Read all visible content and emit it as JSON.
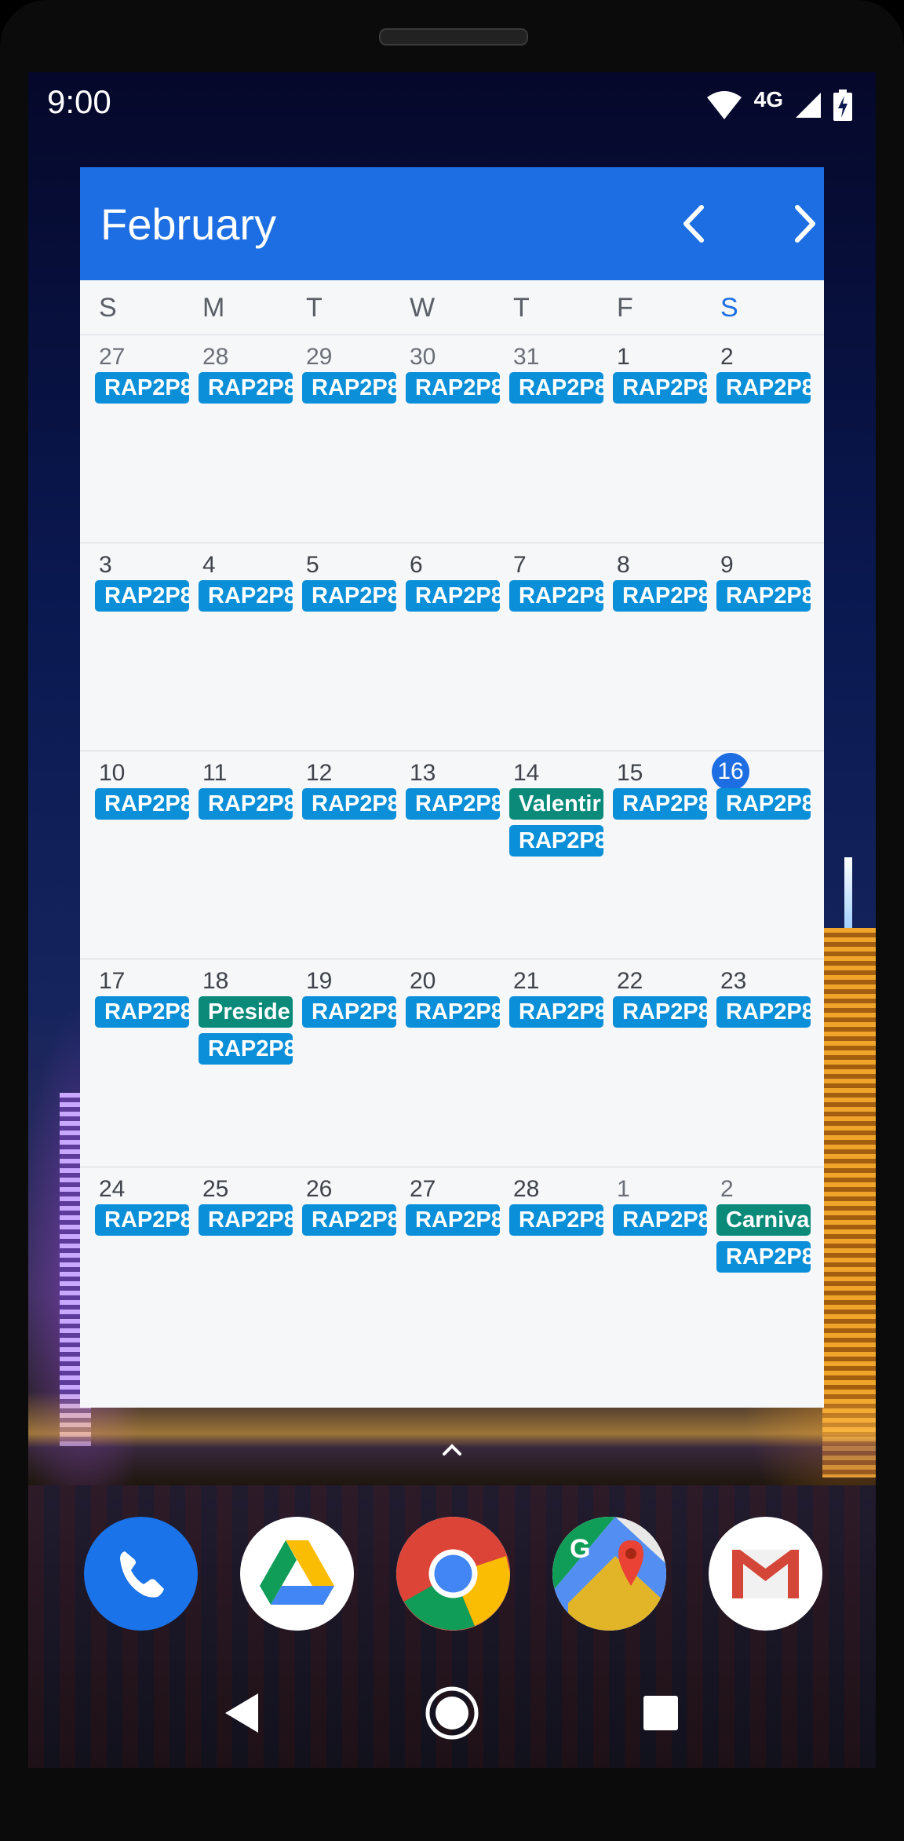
{
  "status_bar": {
    "time": "9:00",
    "network": "4G",
    "icons": [
      "wifi-icon",
      "cell-signal-icon",
      "battery-charging-icon"
    ]
  },
  "widget": {
    "month": "February",
    "prev_icon": "chevron-left-icon",
    "next_icon": "chevron-right-icon",
    "weekdays": [
      "S",
      "M",
      "T",
      "W",
      "T",
      "F",
      "S"
    ],
    "weeks": [
      {
        "days": [
          {
            "n": "27",
            "events": [
              "RAP2P8"
            ]
          },
          {
            "n": "28",
            "events": [
              "RAP2P8"
            ]
          },
          {
            "n": "29",
            "events": [
              "RAP2P8"
            ]
          },
          {
            "n": "30",
            "events": [
              "RAP2P8"
            ]
          },
          {
            "n": "31",
            "events": [
              "RAP2P8"
            ]
          },
          {
            "n": "1",
            "events": [
              "RAP2P8"
            ]
          },
          {
            "n": "2",
            "events": [
              "RAP2P8"
            ]
          }
        ]
      },
      {
        "days": [
          {
            "n": "3",
            "events": [
              "RAP2P8"
            ]
          },
          {
            "n": "4",
            "events": [
              "RAP2P8"
            ]
          },
          {
            "n": "5",
            "events": [
              "RAP2P8"
            ]
          },
          {
            "n": "6",
            "events": [
              "RAP2P8"
            ]
          },
          {
            "n": "7",
            "events": [
              "RAP2P8"
            ]
          },
          {
            "n": "8",
            "events": [
              "RAP2P8"
            ]
          },
          {
            "n": "9",
            "events": [
              "RAP2P8"
            ]
          }
        ]
      },
      {
        "days": [
          {
            "n": "10",
            "events": [
              "RAP2P8"
            ]
          },
          {
            "n": "11",
            "events": [
              "RAP2P8"
            ]
          },
          {
            "n": "12",
            "events": [
              "RAP2P8"
            ]
          },
          {
            "n": "13",
            "events": [
              "RAP2P8"
            ]
          },
          {
            "n": "14",
            "events": [
              "Valentir",
              "RAP2P8"
            ]
          },
          {
            "n": "15",
            "events": [
              "RAP2P8"
            ]
          },
          {
            "n": "16",
            "today": true,
            "events": [
              "RAP2P8"
            ]
          }
        ]
      },
      {
        "days": [
          {
            "n": "17",
            "events": [
              "RAP2P8"
            ]
          },
          {
            "n": "18",
            "events": [
              "Preside",
              "RAP2P8"
            ]
          },
          {
            "n": "19",
            "events": [
              "RAP2P8"
            ]
          },
          {
            "n": "20",
            "events": [
              "RAP2P8"
            ]
          },
          {
            "n": "21",
            "events": [
              "RAP2P8"
            ]
          },
          {
            "n": "22",
            "events": [
              "RAP2P8"
            ]
          },
          {
            "n": "23",
            "events": [
              "RAP2P8"
            ]
          }
        ]
      },
      {
        "days": [
          {
            "n": "24",
            "events": [
              "RAP2P8"
            ]
          },
          {
            "n": "25",
            "events": [
              "RAP2P8"
            ]
          },
          {
            "n": "26",
            "events": [
              "RAP2P8"
            ]
          },
          {
            "n": "27",
            "events": [
              "RAP2P8"
            ]
          },
          {
            "n": "28",
            "events": [
              "RAP2P8"
            ]
          },
          {
            "n": "1",
            "events": [
              "RAP2P8"
            ]
          },
          {
            "n": "2",
            "events": [
              "Carniva",
              "RAP2P8"
            ]
          }
        ]
      }
    ],
    "holiday_events": [
      "Valentir",
      "Preside",
      "Carniva"
    ]
  },
  "dock": {
    "apps": [
      "Phone",
      "Drive",
      "Chrome",
      "Maps",
      "Gmail"
    ]
  },
  "colors": {
    "header": "#1d6ee3",
    "event": "#0b8fd8",
    "holiday": "#0b8a7a",
    "today": "#1d6ee3"
  }
}
